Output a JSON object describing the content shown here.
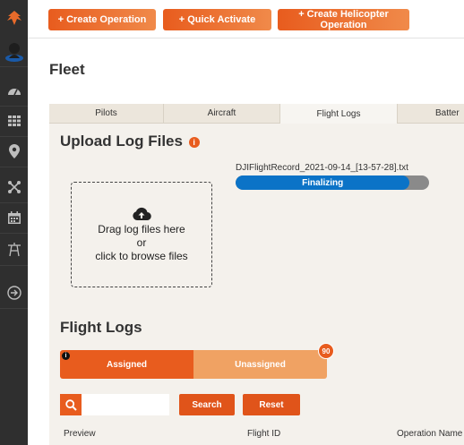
{
  "topbar": {
    "create_operation": "+ Create Operation",
    "quick_activate": "+ Quick Activate",
    "create_helicopter_operation": "+ Create Helicopter Operation"
  },
  "page": {
    "title": "Fleet"
  },
  "tabs": [
    {
      "label": "Pilots"
    },
    {
      "label": "Aircraft"
    },
    {
      "label": "Flight Logs"
    },
    {
      "label": "Batter"
    }
  ],
  "upload": {
    "title": "Upload Log Files",
    "info_icon": "i",
    "dropzone_line1": "Drag log files here",
    "dropzone_line2": "or",
    "dropzone_line3": "click to browse files",
    "file_name": "DJIFlightRecord_2021-09-14_[13-57-28].txt",
    "status": "Finalizing",
    "progress": 0.9
  },
  "flight_logs": {
    "title": "Flight Logs",
    "assigned_label": "Assigned",
    "assigned_info_icon": "i",
    "unassigned_label": "Unassigned",
    "unassigned_count": "90",
    "search_placeholder": "",
    "search_button": "Search",
    "reset_button": "Reset",
    "columns": [
      "Preview",
      "Flight ID",
      "Operation Name"
    ]
  },
  "colors": {
    "accent": "#e85c1e",
    "accent_light": "#f0a263",
    "sidebar_bg": "#2f2f2f",
    "progress_blue": "#0b73c7"
  },
  "sidebar_icons": [
    "logo-icon",
    "user-avatar-icon",
    "dashboard-icon",
    "grid-icon",
    "location-pin-icon",
    "drone-icon",
    "calendar-icon",
    "tower-icon",
    "logout-icon"
  ]
}
